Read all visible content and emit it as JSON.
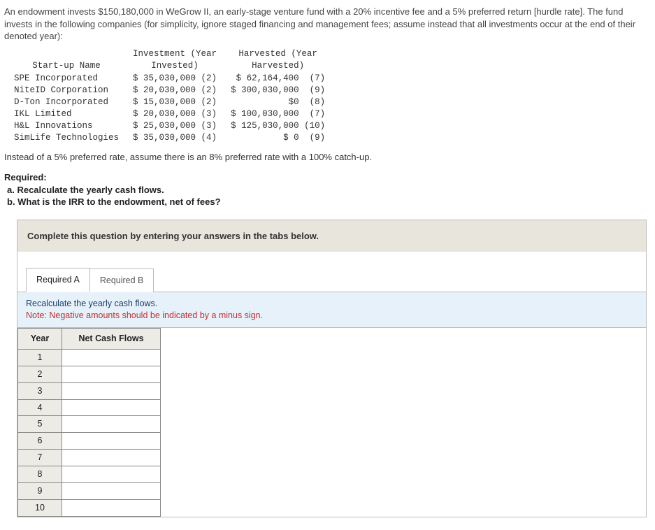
{
  "intro": "An endowment invests $150,180,000 in WeGrow II, an early-stage venture fund with a 20% incentive fee and a 5% preferred return [hurdle rate]. The fund invests in the following companies (for simplicity, ignore staged financing and management fees; assume instead that all investments occur at the end of their denoted year):",
  "startup_table": {
    "headers": {
      "name": "Start-up Name",
      "invest": "Investment (Year\nInvested)",
      "harvest": "Harvested (Year\nHarvested)"
    },
    "rows": [
      {
        "name": "SPE Incorporated",
        "invest": "$ 35,030,000 (2)",
        "harvest": "$ 62,164,400  (7)"
      },
      {
        "name": "NiteID Corporation",
        "invest": "$ 20,030,000 (2)",
        "harvest": "$ 300,030,000  (9)"
      },
      {
        "name": "D-Ton Incorporated",
        "invest": "$ 15,030,000 (2)",
        "harvest": "$0  (8)"
      },
      {
        "name": "IKL Limited",
        "invest": "$ 20,030,000 (3)",
        "harvest": "$ 100,030,000  (7)"
      },
      {
        "name": "H&L Innovations",
        "invest": "$ 25,030,000 (3)",
        "harvest": "$ 125,030,000 (10)"
      },
      {
        "name": "SimLife Technologies",
        "invest": "$ 35,030,000 (4)",
        "harvest": "$ 0  (9)"
      }
    ]
  },
  "modifier": "Instead of a 5% preferred rate, assume there is an 8% preferred rate with a 100% catch-up.",
  "required": {
    "heading": "Required:",
    "a": "a. Recalculate the yearly cash flows.",
    "b": "b. What is the IRR to the endowment, net of fees?"
  },
  "panel": {
    "instruction": "Complete this question by entering your answers in the tabs below.",
    "tabs": {
      "a": "Required A",
      "b": "Required B"
    },
    "prompt_line1": "Recalculate the yearly cash flows.",
    "prompt_note": "Note: Negative amounts should be indicated by a minus sign.",
    "cf_headers": {
      "year": "Year",
      "ncf": "Net Cash Flows"
    },
    "years": [
      "1",
      "2",
      "3",
      "4",
      "5",
      "6",
      "7",
      "8",
      "9",
      "10"
    ]
  }
}
